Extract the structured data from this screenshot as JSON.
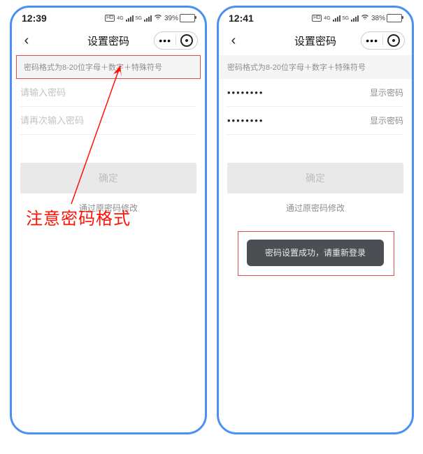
{
  "left_phone": {
    "status": {
      "time": "12:39",
      "battery_label": "39%"
    },
    "nav": {
      "title": "设置密码"
    },
    "hint": "密码格式为8-20位字母＋数字＋特殊符号",
    "field1_placeholder": "请输入密码",
    "field2_placeholder": "请再次输入密码",
    "confirm": "确定",
    "sublink": "通过原密码修改"
  },
  "right_phone": {
    "status": {
      "time": "12:41",
      "battery_label": "38%"
    },
    "nav": {
      "title": "设置密码"
    },
    "hint": "密码格式为8-20位字母＋数字＋特殊符号",
    "field1_value": "••••••••",
    "show_label": "显示密码",
    "field2_value": "••••••••",
    "confirm": "确定",
    "sublink": "通过原密码修改",
    "toast": "密码设置成功，请重新登录"
  },
  "annotation": {
    "note": "注意密码格式"
  }
}
